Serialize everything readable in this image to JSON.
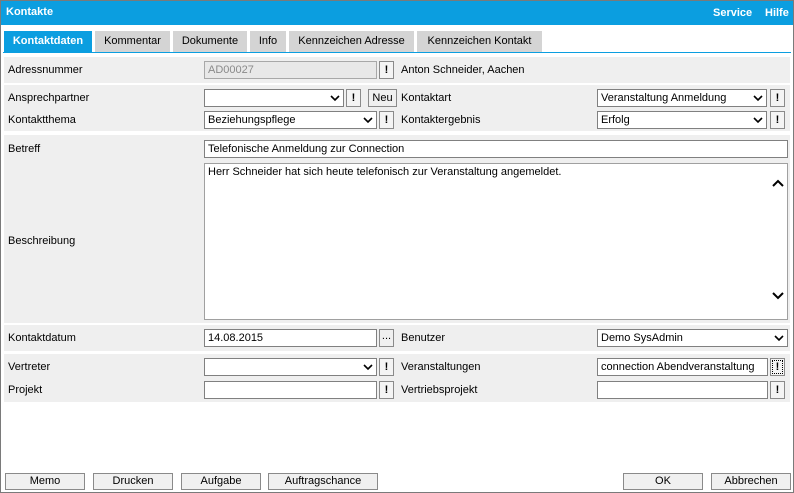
{
  "window": {
    "title": "Kontakte",
    "service_link": "Service",
    "help_link": "Hilfe"
  },
  "tabs": [
    {
      "label": "Kontaktdaten",
      "active": true
    },
    {
      "label": "Kommentar"
    },
    {
      "label": "Dokumente"
    },
    {
      "label": "Info"
    },
    {
      "label": "Kennzeichen Adresse"
    },
    {
      "label": "Kennzeichen Kontakt"
    }
  ],
  "form": {
    "adressnummer": {
      "label": "Adressnummer",
      "value": "AD00027",
      "display": "Anton Schneider, Aachen"
    },
    "ansprechpartner": {
      "label": "Ansprechpartner",
      "value": "",
      "new_button": "Neu"
    },
    "kontaktart": {
      "label": "Kontaktart",
      "value": "Veranstaltung Anmeldung"
    },
    "kontaktthema": {
      "label": "Kontaktthema",
      "value": "Beziehungspflege"
    },
    "kontaktergebnis": {
      "label": "Kontaktergebnis",
      "value": "Erfolg"
    },
    "betreff": {
      "label": "Betreff",
      "value": "Telefonische Anmeldung zur Connection"
    },
    "beschreibung": {
      "label": "Beschreibung",
      "value": "Herr Schneider hat sich heute telefonisch zur Veranstaltung angemeldet."
    },
    "kontaktdatum": {
      "label": "Kontaktdatum",
      "value": "14.08.2015",
      "picker": "..."
    },
    "benutzer": {
      "label": "Benutzer",
      "value": "Demo SysAdmin"
    },
    "vertreter": {
      "label": "Vertreter",
      "value": ""
    },
    "veranstaltungen": {
      "label": "Veranstaltungen",
      "value": "connection Abendveranstaltung"
    },
    "projekt": {
      "label": "Projekt",
      "value": ""
    },
    "vertriebsprojekt": {
      "label": "Vertriebsprojekt",
      "value": ""
    },
    "info_button": "!"
  },
  "buttons": {
    "memo": "Memo",
    "drucken": "Drucken",
    "aufgabe": "Aufgabe",
    "auftragschance": "Auftragschance",
    "ok": "OK",
    "abbrechen": "Abbrechen"
  }
}
